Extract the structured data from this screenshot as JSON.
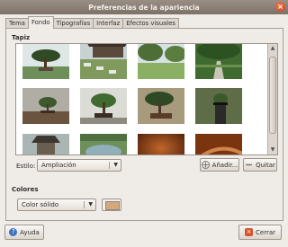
{
  "window": {
    "title": "Preferencias de la apariencia",
    "close_glyph": "×"
  },
  "tabs": [
    {
      "label": "Tema"
    },
    {
      "label": "Fondo"
    },
    {
      "label": "Tipografías"
    },
    {
      "label": "Interfaz"
    },
    {
      "label": "Efectos visuales"
    }
  ],
  "wallpaper": {
    "section_title": "Tapiz",
    "thumbnails": [
      {
        "icon": "bonsai-photo",
        "bg": "#6f8f5a"
      },
      {
        "icon": "japanese-garden-photo",
        "bg": "#7f8f6c"
      },
      {
        "icon": "lawn-trees-photo",
        "bg": "#7ea05c"
      },
      {
        "icon": "park-path-photo",
        "bg": "#4f7a3f"
      },
      {
        "icon": "bonsai-table-photo",
        "bg": "#a7a39a"
      },
      {
        "icon": "bonsai-white-wall-photo",
        "bg": "#c9c9c1"
      },
      {
        "icon": "bonsai-pot-photo",
        "bg": "#9a8c70"
      },
      {
        "icon": "bonsai-stand-photo",
        "bg": "#6e7a54"
      },
      {
        "icon": "pavilion-photo",
        "bg": "#8e9a88"
      },
      {
        "icon": "garden-pond-photo",
        "bg": "#7d9a6a"
      },
      {
        "icon": "brown-texture-wallpaper",
        "bg": "#7a3a12"
      },
      {
        "icon": "brown-swirl-wallpaper",
        "bg": "#8c4515"
      }
    ],
    "style_label": "Estilo:",
    "style_value": "Ampliación",
    "add_label": "Añadir...",
    "remove_label": "Quitar"
  },
  "colors": {
    "section_title": "Colores",
    "mode_value": "Color sólido",
    "swatch_color": "#d3a97c"
  },
  "footer": {
    "help_label": "Ayuda",
    "close_label": "Cerrar"
  }
}
